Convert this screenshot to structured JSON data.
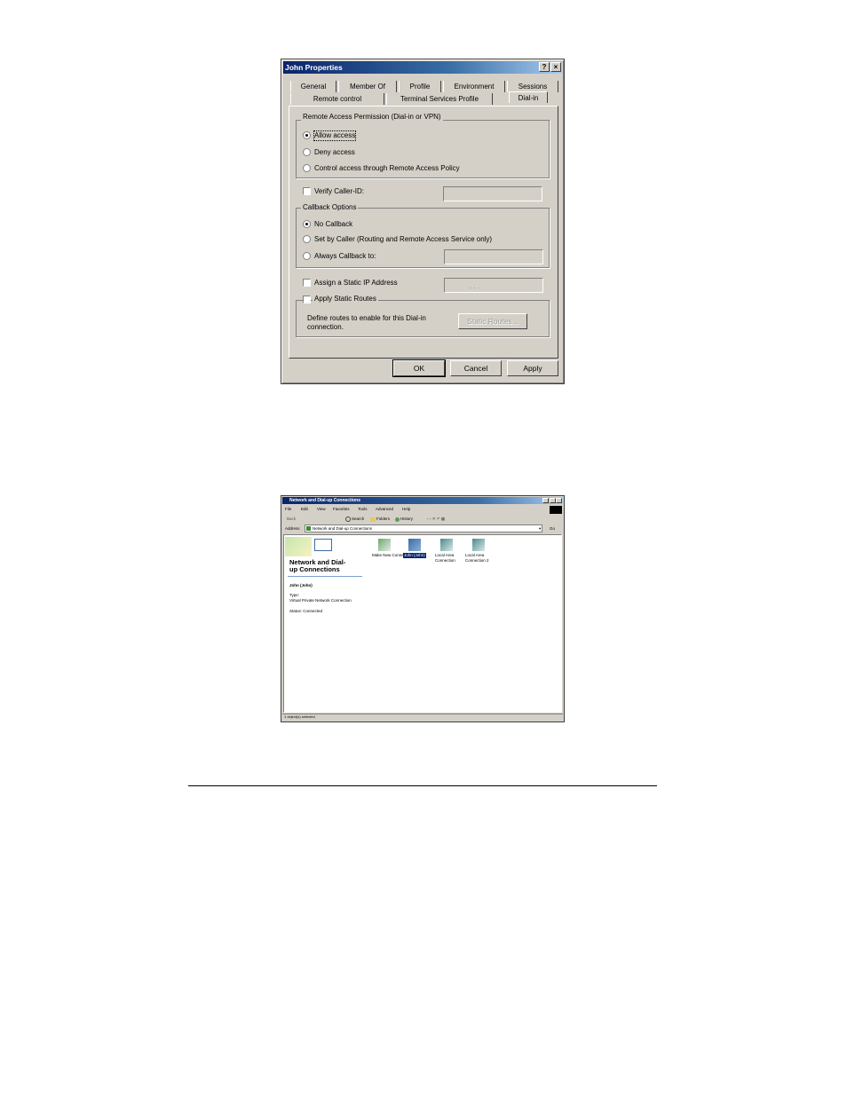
{
  "dialog": {
    "title": "John Properties",
    "help_btn": "?",
    "close_btn": "×",
    "tabs_row1": [
      "General",
      "Member Of",
      "Profile",
      "Environment",
      "Sessions"
    ],
    "tabs_row2": [
      "Remote control",
      "Terminal Services Profile",
      "Dial-in"
    ],
    "remote_access": {
      "title": "Remote Access Permission (Dial-in or VPN)",
      "allow": "Allow access",
      "deny": "Deny access",
      "policy": "Control access through Remote Access Policy"
    },
    "verify_caller": "Verify Caller-ID:",
    "callback": {
      "title": "Callback Options",
      "none": "No Callback",
      "by_caller": "Set by Caller (Routing and Remote Access Service only)",
      "always": "Always Callback to:"
    },
    "static_ip": "Assign a Static IP Address",
    "ip_placeholder": ".     .     .",
    "static_routes": "Apply Static Routes",
    "routes_desc_1": "Define routes to enable for this Dial-in",
    "routes_desc_2": "connection.",
    "static_routes_btn": "Static Routes...",
    "ok": "OK",
    "cancel": "Cancel",
    "apply": "Apply"
  },
  "window": {
    "title": "Network and Dial-up Connections",
    "menu": [
      "File",
      "Edit",
      "View",
      "Favorites",
      "Tools",
      "Advanced",
      "Help"
    ],
    "toolbar": {
      "back": "Back",
      "search": "Search",
      "folders": "Folders",
      "history": "History"
    },
    "address_label": "Address",
    "address_value": "Network and Dial-up Connections",
    "go": "Go",
    "panel_title_1": "Network and Dial-",
    "panel_title_2": "up Connections",
    "selected_name": "John (John)",
    "type_label": "Type:",
    "type_value": "Virtual Private Network Connection",
    "status_value": "Status: Connected",
    "icons": [
      "Make New Connection",
      "John (John)",
      "Local Area Connection",
      "Local Area Connection 2"
    ],
    "statusbar": "1 object(s) selected"
  }
}
